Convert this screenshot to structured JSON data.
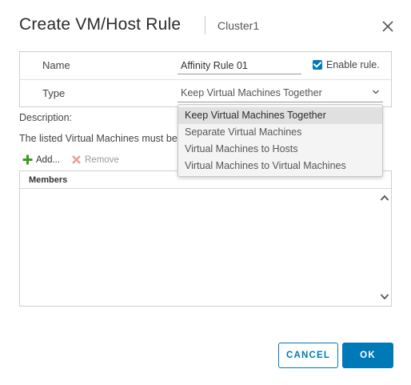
{
  "header": {
    "title": "Create VM/Host Rule",
    "subtitle": "Cluster1"
  },
  "form": {
    "name_label": "Name",
    "name_value": "Affinity Rule 01",
    "enable_label": "Enable rule.",
    "enable_checked": true,
    "type_label": "Type",
    "type_value": "Keep Virtual Machines Together"
  },
  "dropdown": {
    "options": [
      "Keep Virtual Machines Together",
      "Separate Virtual Machines",
      "Virtual Machines to Hosts",
      "Virtual Machines to Virtual Machines"
    ],
    "selected_index": 0
  },
  "description": {
    "label": "Description:",
    "text": "The listed Virtual Machines must be"
  },
  "toolbar": {
    "add_label": "Add...",
    "remove_label": "Remove"
  },
  "grid": {
    "column_header": "Members",
    "rows": []
  },
  "footer": {
    "cancel_label": "CANCEL",
    "ok_label": "OK"
  },
  "colors": {
    "accent": "#0079b8",
    "add_icon": "#3c9a1e",
    "remove_icon_disabled": "#e8a0a0"
  }
}
